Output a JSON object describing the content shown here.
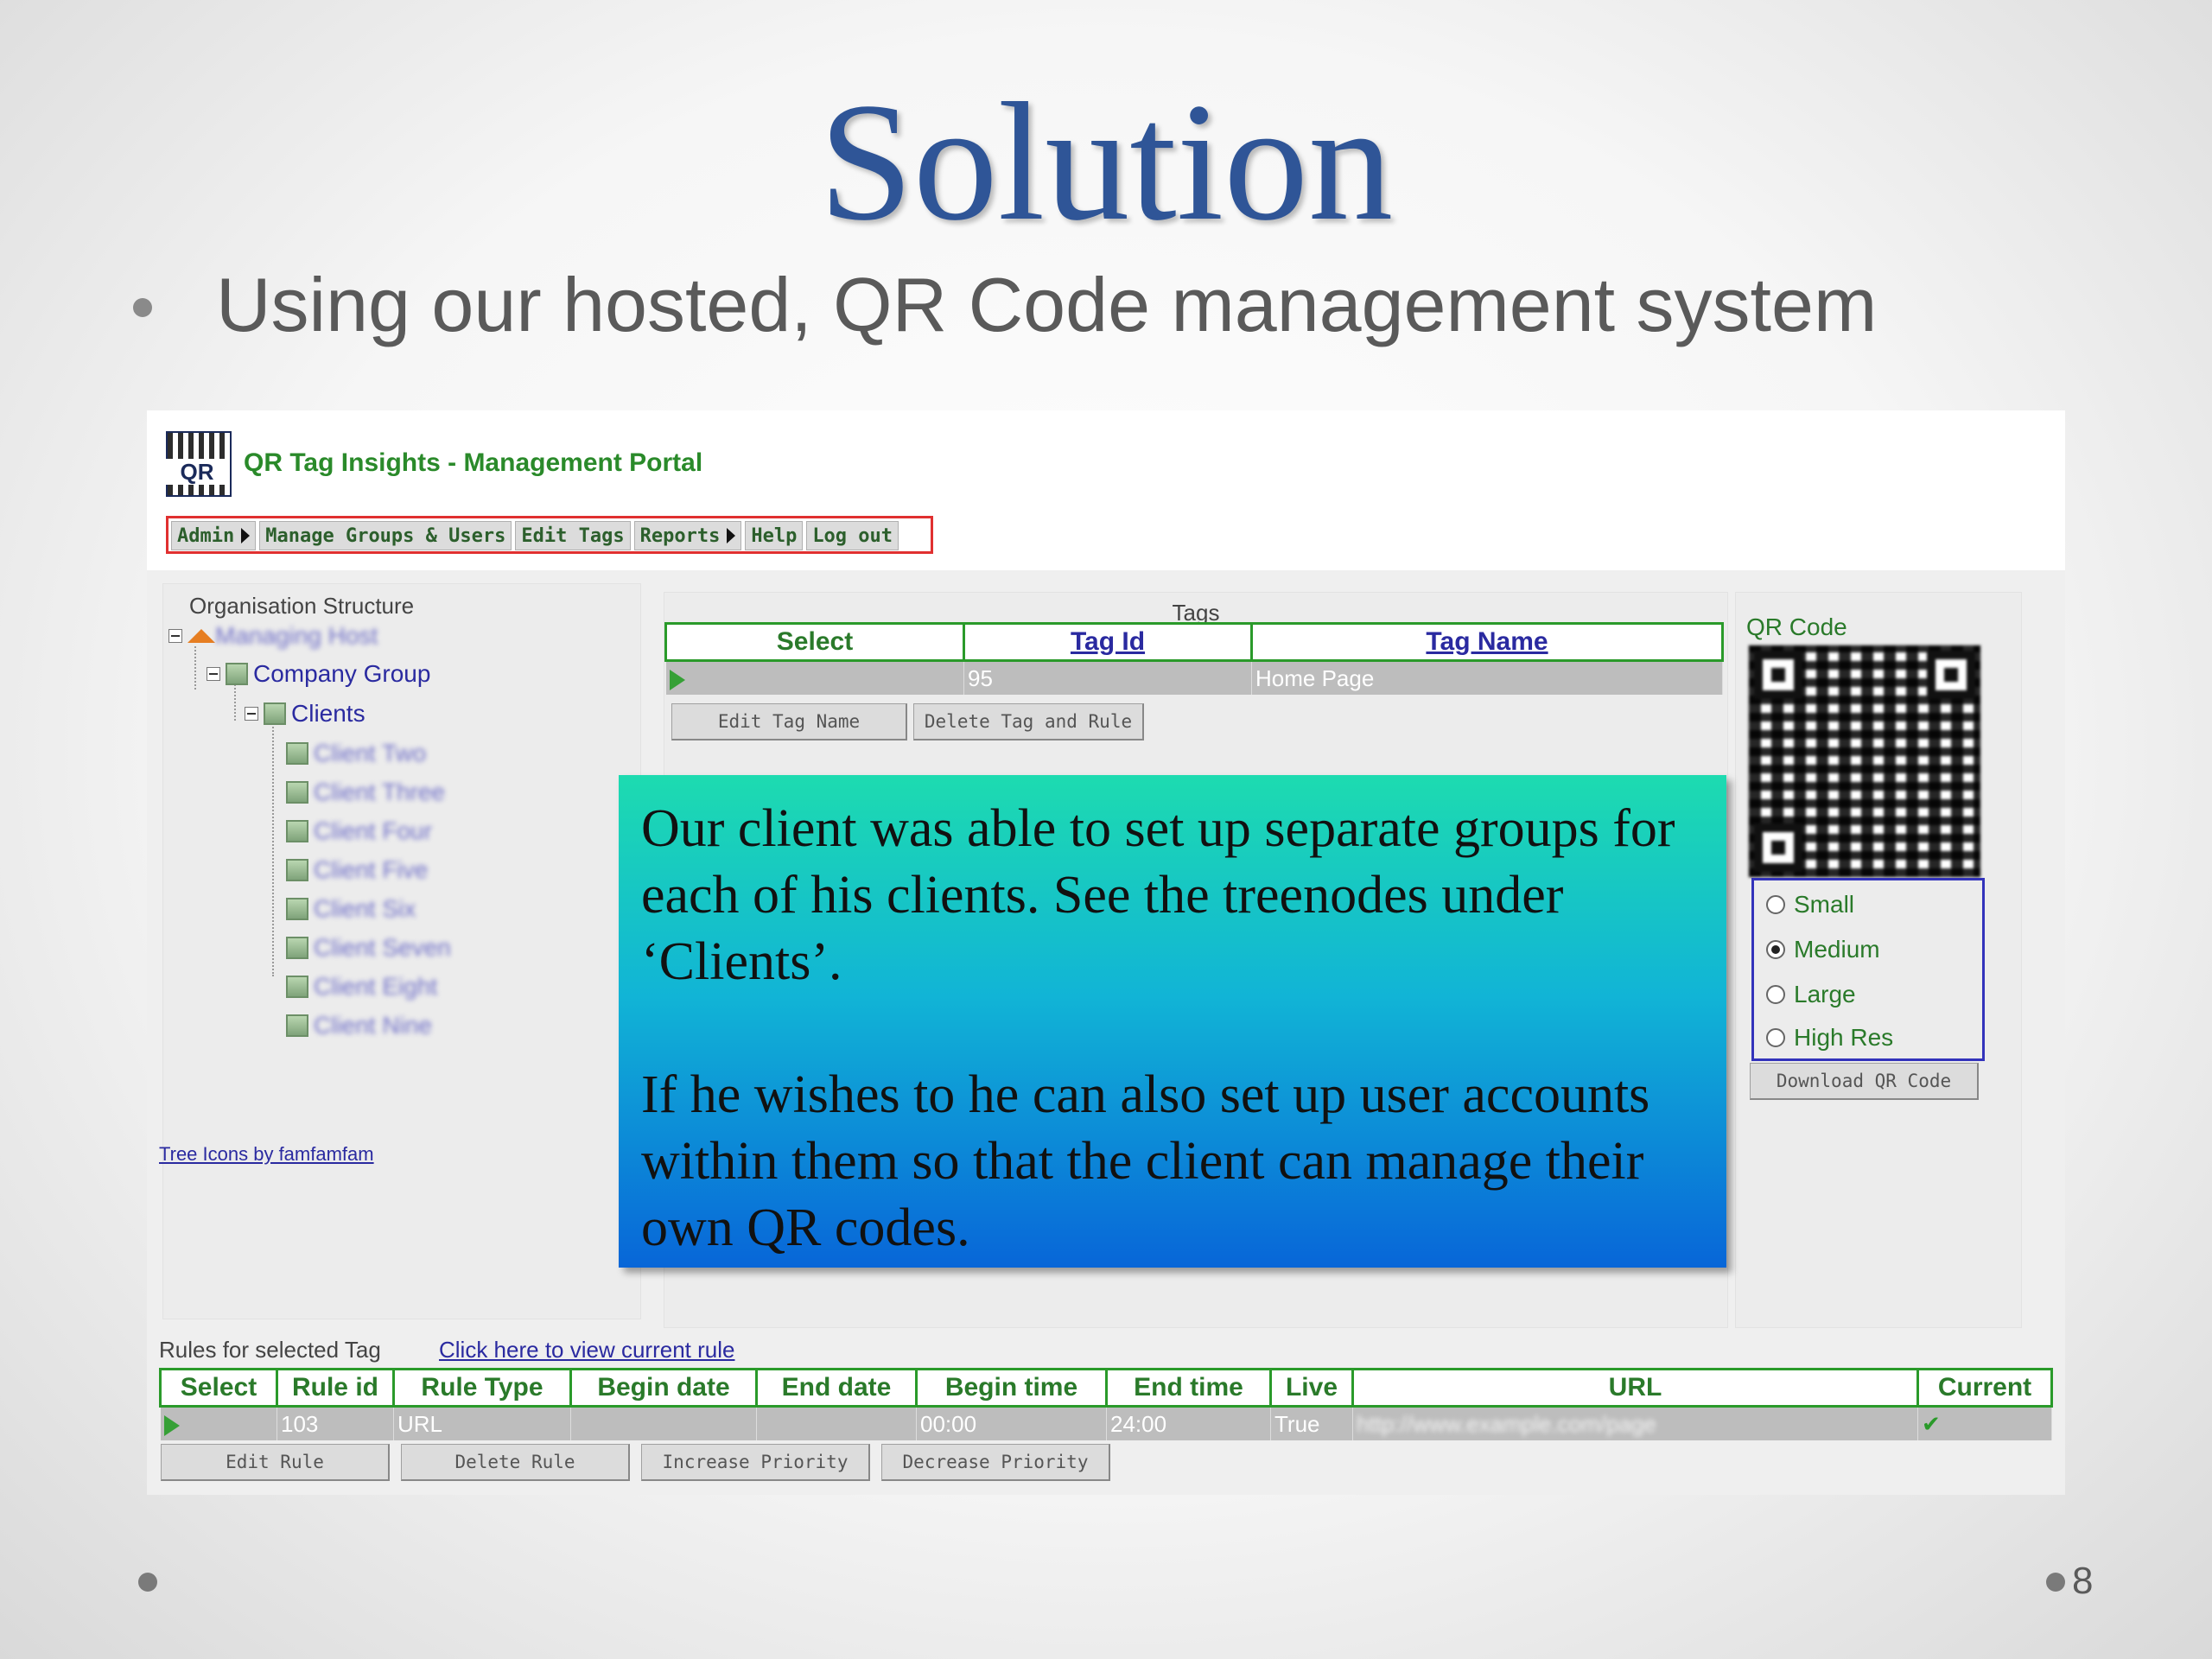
{
  "slide": {
    "title": "Solution",
    "bullet": "Using our hosted, QR Code management system",
    "page_number": "8"
  },
  "portal": {
    "logo_text": "QR",
    "title": "QR Tag Insights - Management Portal",
    "menu": [
      {
        "label": "Admin",
        "has_submenu": true
      },
      {
        "label": "Manage Groups & Users",
        "has_submenu": false
      },
      {
        "label": "Edit Tags",
        "has_submenu": false
      },
      {
        "label": "Reports",
        "has_submenu": true
      },
      {
        "label": "Help",
        "has_submenu": false
      },
      {
        "label": "Log out",
        "has_submenu": false
      }
    ]
  },
  "org": {
    "heading": "Organisation Structure",
    "root": "Managing Host",
    "group": "Company Group",
    "clients_node": "Clients",
    "clients": [
      "Client Two",
      "Client Three",
      "Client Four",
      "Client Five",
      "Client Six",
      "Client Seven",
      "Client Eight",
      "Client Nine"
    ],
    "credit_link": "Tree Icons by famfamfam"
  },
  "tags": {
    "heading": "Tags",
    "columns": [
      "Select",
      "Tag Id",
      "Tag Name"
    ],
    "row": {
      "tag_id": "95",
      "tag_name": "Home Page"
    },
    "buttons": [
      "Edit Tag Name",
      "Delete Tag and Rule"
    ]
  },
  "qr": {
    "heading": "QR Code",
    "sizes": [
      "Small",
      "Medium",
      "Large",
      "High Res"
    ],
    "selected_size": "Medium",
    "download_label": "Download QR Code"
  },
  "rules": {
    "heading": "Rules for selected Tag",
    "link": "Click here to view current rule",
    "columns": [
      "Select",
      "Rule id",
      "Rule Type",
      "Begin date",
      "End date",
      "Begin time",
      "End time",
      "Live",
      "URL",
      "Current"
    ],
    "row": {
      "rule_id": "103",
      "rule_type": "URL",
      "begin_date": "",
      "end_date": "",
      "begin_time": "00:00",
      "end_time": "24:00",
      "live": "True",
      "url": "http://www.example.com/page",
      "current": "✔"
    },
    "buttons": [
      "Edit Rule",
      "Delete Rule",
      "Increase Priority",
      "Decrease Priority"
    ]
  },
  "callout": {
    "para1": "Our client was able to set up separate groups for each of his clients. See the treenodes under ‘Clients’.",
    "para2": "If he wishes to he can also set up user accounts within them so that the client can manage their own QR codes."
  },
  "colors": {
    "title": "#2f5597",
    "portal_green": "#2a8a2a",
    "link_blue": "#2a2aa0",
    "menu_border": "#e03030",
    "callout_top": "#1ddbb0",
    "callout_bottom": "#0866d8"
  }
}
